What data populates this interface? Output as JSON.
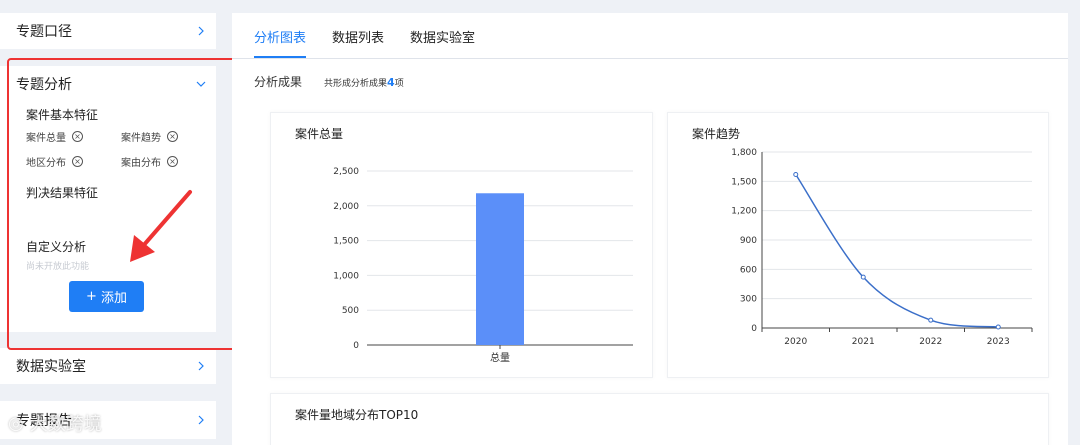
{
  "sidebar": {
    "topic_caliber": "专题口径",
    "topic_analysis": "专题分析",
    "basic_features_title": "案件基本特征",
    "tags": [
      "案件总量",
      "案件趋势",
      "地区分布",
      "案由分布"
    ],
    "judgment_features_title": "判决结果特征",
    "custom_analysis_title": "自定义分析",
    "custom_hint": "尚未开放此功能",
    "add_button": "添加",
    "data_lab": "数据实验室",
    "topic_report": "专题报告"
  },
  "tabs": [
    "分析图表",
    "数据列表",
    "数据实验室"
  ],
  "results": {
    "label": "分析成果",
    "prefix": "共形成分析成果",
    "count": "4",
    "suffix": "项"
  },
  "panels": {
    "total_title": "案件总量",
    "trend_title": "案件趋势",
    "region_title": "案件量地域分布TOP10"
  },
  "watermark": "大数跨境",
  "colors": {
    "accent": "#1f7ef5",
    "bar": "#5b8ff9",
    "line": "#3b6fc9",
    "annotation": "#e33333"
  },
  "chart_data": [
    {
      "type": "bar",
      "title": "案件总量",
      "categories": [
        "总量"
      ],
      "values": [
        2180
      ],
      "ylim": [
        0,
        2500
      ],
      "yticks": [
        "0",
        "500",
        "1,000",
        "1,500",
        "2,000",
        "2,500"
      ]
    },
    {
      "type": "line",
      "title": "案件趋势",
      "x": [
        "2020",
        "2021",
        "2022",
        "2023"
      ],
      "values": [
        1570,
        520,
        80,
        10
      ],
      "ylim": [
        0,
        1800
      ],
      "yticks": [
        "0",
        "300",
        "600",
        "900",
        "1,200",
        "1,500",
        "1,800"
      ]
    }
  ]
}
